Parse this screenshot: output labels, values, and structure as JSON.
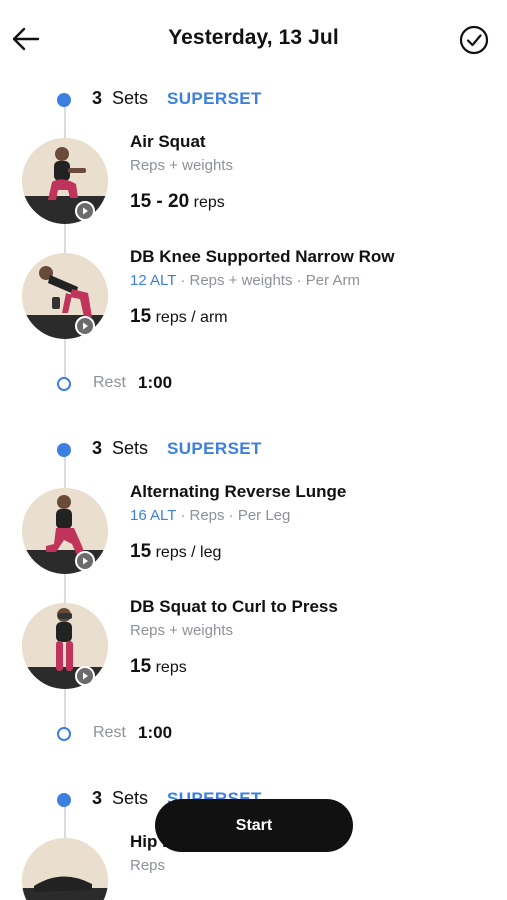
{
  "header": {
    "title": "Yesterday, 13 Jul"
  },
  "icons": {
    "back": "arrow-left-icon",
    "done": "check-circle-icon",
    "play": "play-icon"
  },
  "colors": {
    "accent": "#3d7fe0",
    "text": "#111111",
    "muted": "#8d9199",
    "button": "#111111"
  },
  "groups": [
    {
      "sets_count": "3",
      "sets_label": "Sets",
      "tag": "SUPERSET",
      "exercises": [
        {
          "name": "Air Squat",
          "alt": "",
          "meta": "Reps + weights",
          "reps": "15 - 20",
          "unit": "reps"
        },
        {
          "name": "DB Knee Supported Narrow Row",
          "alt": "12 ALT",
          "meta": " · Reps + weights · Per Arm",
          "reps": "15",
          "unit": "reps / arm"
        }
      ],
      "rest_label": "Rest",
      "rest_time": "1:00"
    },
    {
      "sets_count": "3",
      "sets_label": "Sets",
      "tag": "SUPERSET",
      "exercises": [
        {
          "name": "Alternating Reverse Lunge",
          "alt": "16 ALT",
          "meta": " · Reps · Per Leg",
          "reps": "15",
          "unit": "reps / leg"
        },
        {
          "name": "DB Squat to Curl to Press",
          "alt": "",
          "meta": "Reps + weights",
          "reps": "15",
          "unit": "reps"
        }
      ],
      "rest_label": "Rest",
      "rest_time": "1:00"
    },
    {
      "sets_count": "3",
      "sets_label": "Sets",
      "tag": "SUPERSET",
      "exercises": [
        {
          "name": "Hip Bridge",
          "alt": "",
          "meta": "Reps",
          "reps": "",
          "unit": ""
        }
      ]
    }
  ],
  "start_label": "Start"
}
